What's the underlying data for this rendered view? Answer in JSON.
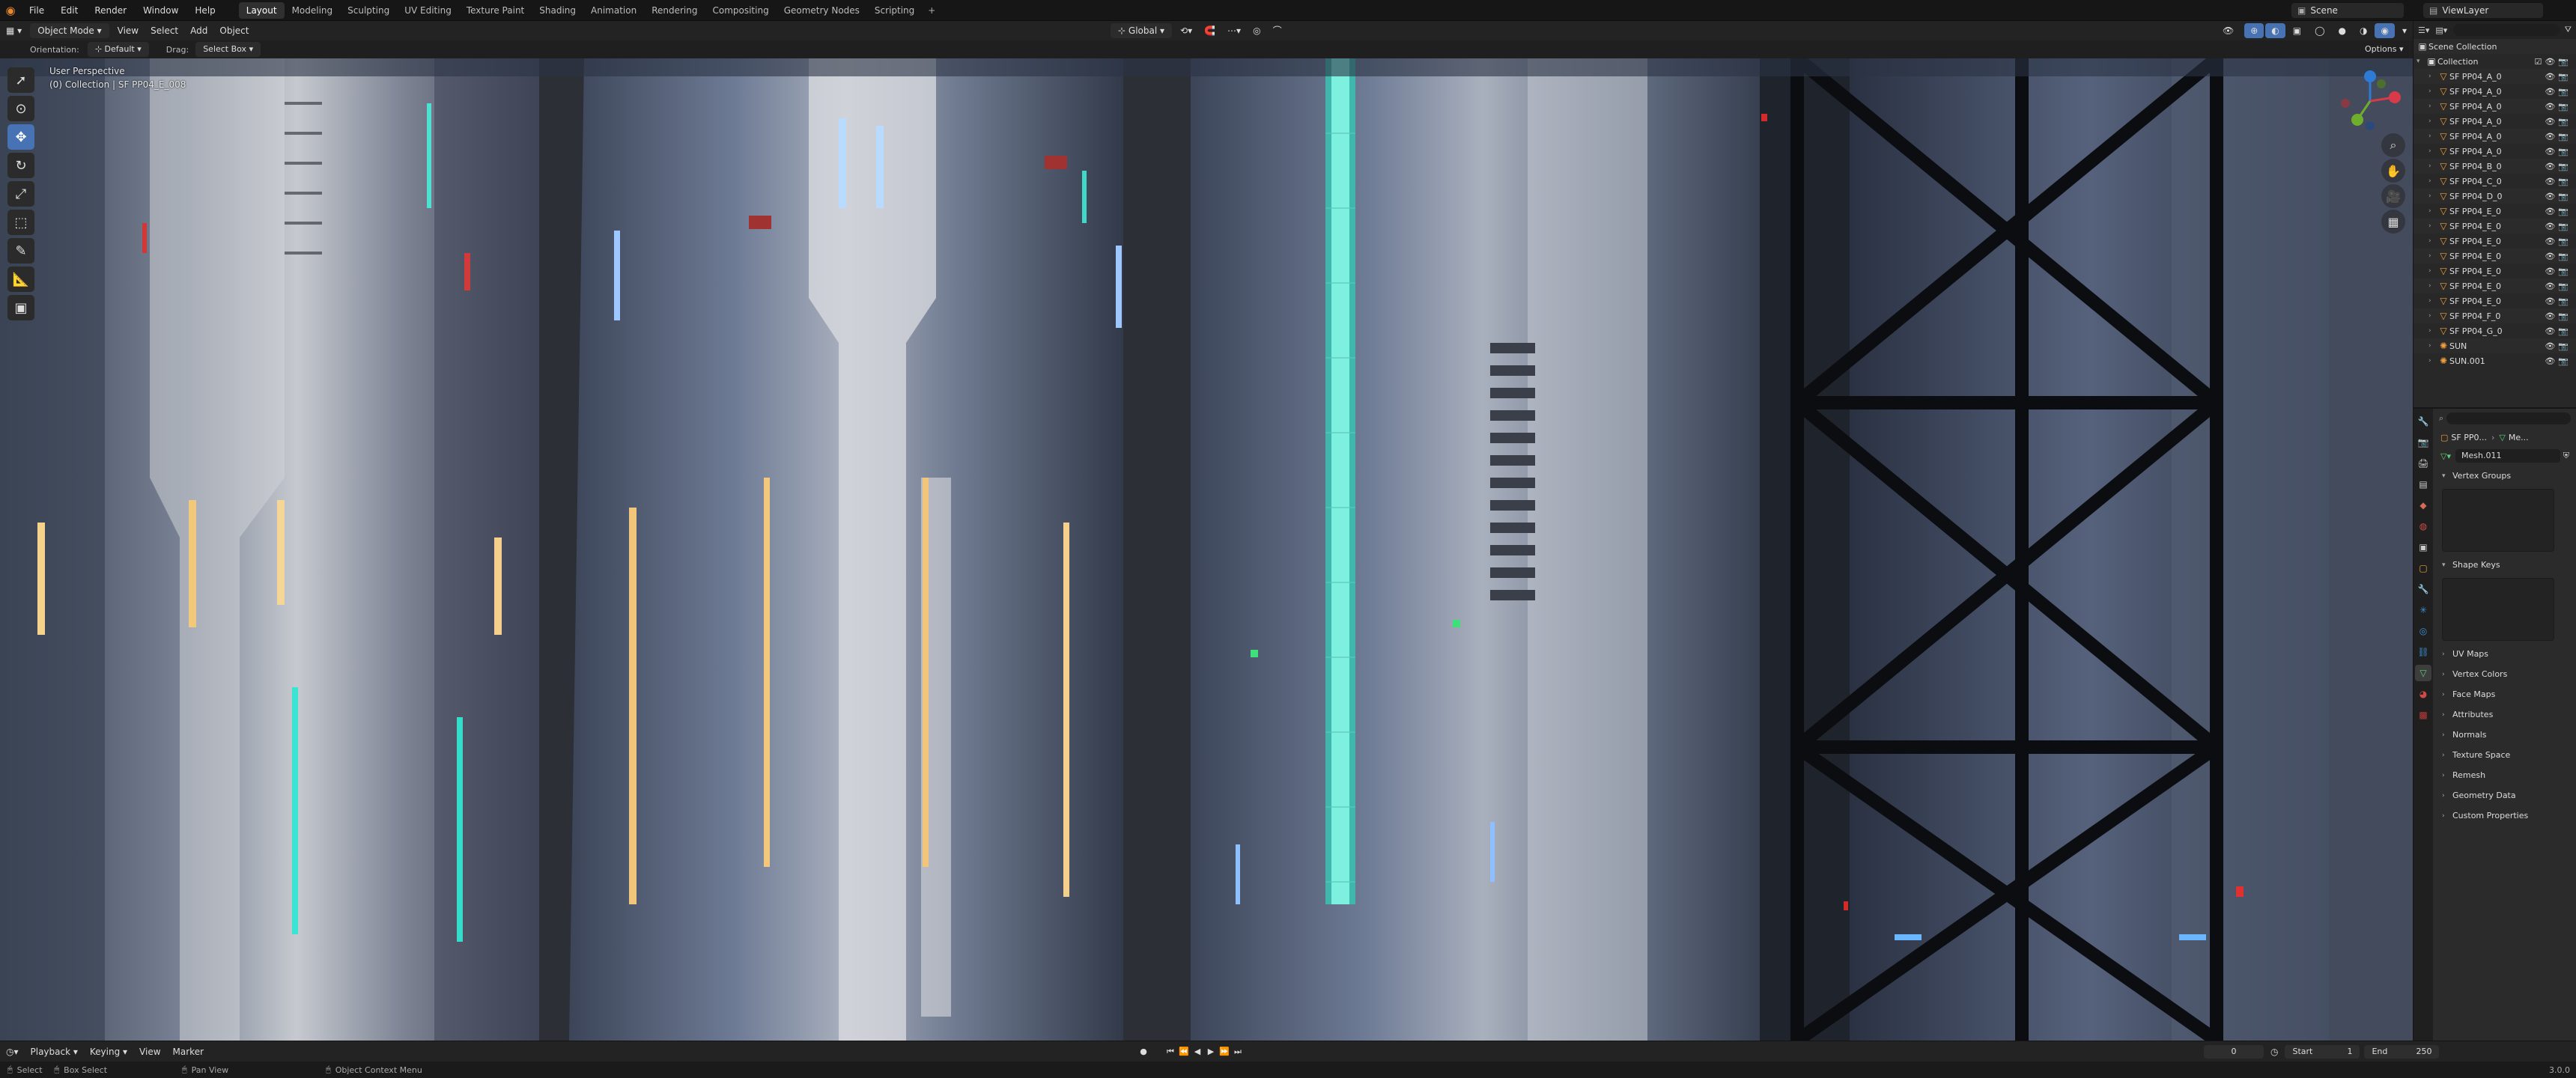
{
  "app": {
    "logo_icon": "blender-logo-icon"
  },
  "menu": [
    "File",
    "Edit",
    "Render",
    "Window",
    "Help"
  ],
  "workspaces": [
    "Layout",
    "Modeling",
    "Sculpting",
    "UV Editing",
    "Texture Paint",
    "Shading",
    "Animation",
    "Rendering",
    "Compositing",
    "Geometry Nodes",
    "Scripting"
  ],
  "active_workspace": "Layout",
  "topright": {
    "scene": "Scene",
    "view_layer": "ViewLayer"
  },
  "viewport_header": {
    "mode": "Object Mode",
    "menus": [
      "View",
      "Select",
      "Add",
      "Object"
    ],
    "transform": "Global"
  },
  "tool_settings": {
    "orientation_label": "Orientation:",
    "orientation": "Default",
    "drag_label": "Drag:",
    "drag": "Select Box",
    "options": "Options"
  },
  "overlay": {
    "line1": "User Perspective",
    "line2": "(0) Collection | SF PP04_E_008"
  },
  "outliner": {
    "root": "Scene Collection",
    "collection": "Collection",
    "items": [
      "SF PP04_A_0",
      "SF PP04_A_0",
      "SF PP04_A_0",
      "SF PP04_A_0",
      "SF PP04_A_0",
      "SF PP04_A_0",
      "SF PP04_B_0",
      "SF PP04_C_0",
      "SF PP04_D_0",
      "SF PP04_E_0",
      "SF PP04_E_0",
      "SF PP04_E_0",
      "SF PP04_E_0",
      "SF PP04_E_0",
      "SF PP04_E_0",
      "SF PP04_E_0",
      "SF PP04_F_0",
      "SF PP04_G_0",
      "SUN",
      "SUN.001"
    ]
  },
  "properties": {
    "breadcrumb_obj": "SF PP0...",
    "breadcrumb_data": "Me...",
    "mesh_name": "Mesh.011",
    "sections": [
      "Vertex Groups",
      "Shape Keys",
      "UV Maps",
      "Vertex Colors",
      "Face Maps",
      "Attributes",
      "Normals",
      "Texture Space",
      "Remesh",
      "Geometry Data",
      "Custom Properties"
    ]
  },
  "timeline": {
    "menus": [
      "Playback",
      "Keying",
      "View",
      "Marker"
    ],
    "current_frame": "0",
    "start_label": "Start",
    "start": "1",
    "end_label": "End",
    "end": "250"
  },
  "status": {
    "select": "Select",
    "box_select": "Box Select",
    "pan_view": "Pan View",
    "context_menu": "Object Context Menu",
    "version": "3.0.0"
  }
}
